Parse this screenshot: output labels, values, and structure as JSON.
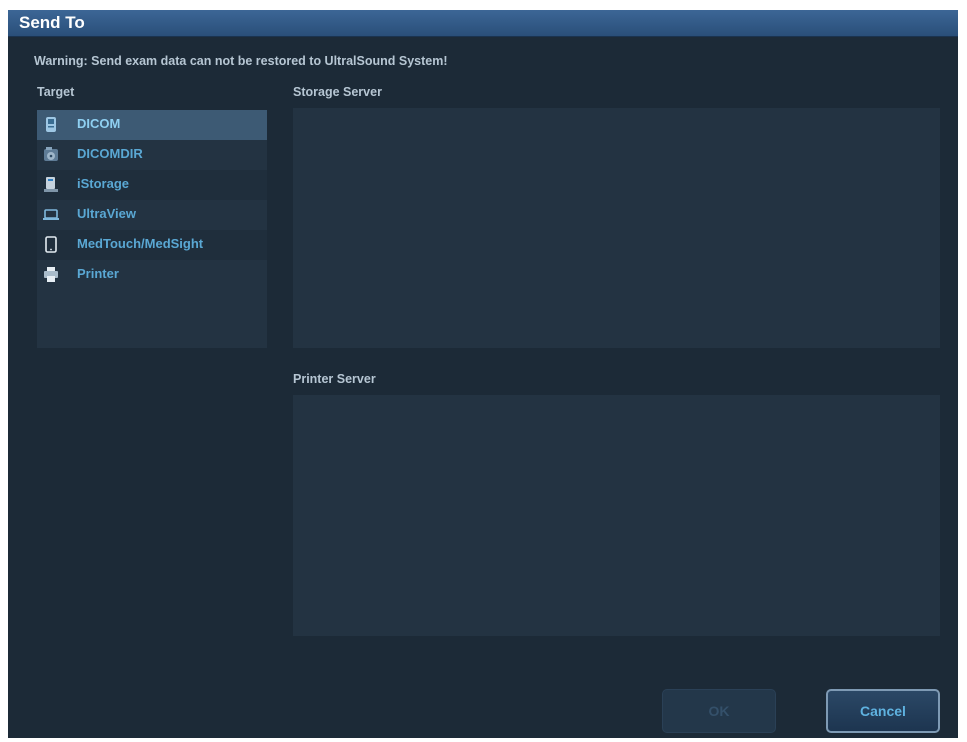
{
  "dialog": {
    "title": "Send To",
    "warning": "Warning: Send exam data can not be restored to UltralSound System!"
  },
  "target": {
    "label": "Target",
    "items": [
      {
        "label": "DICOM",
        "icon": "dicom-device-icon",
        "selected": true
      },
      {
        "label": "DICOMDIR",
        "icon": "dicomdir-disk-icon",
        "selected": false
      },
      {
        "label": "iStorage",
        "icon": "istorage-server-icon",
        "selected": false
      },
      {
        "label": "UltraView",
        "icon": "laptop-icon",
        "selected": false
      },
      {
        "label": "MedTouch/MedSight",
        "icon": "tablet-icon",
        "selected": false
      },
      {
        "label": "Printer",
        "icon": "printer-icon",
        "selected": false
      }
    ]
  },
  "storage_server": {
    "label": "Storage Server"
  },
  "printer_server": {
    "label": "Printer Server"
  },
  "buttons": {
    "ok": "OK",
    "cancel": "Cancel"
  },
  "colors": {
    "background": "#1c2a37",
    "title_bar": "#2f5a86",
    "list_text": "#5aa8d4",
    "selected_row": "#3d5a74"
  }
}
